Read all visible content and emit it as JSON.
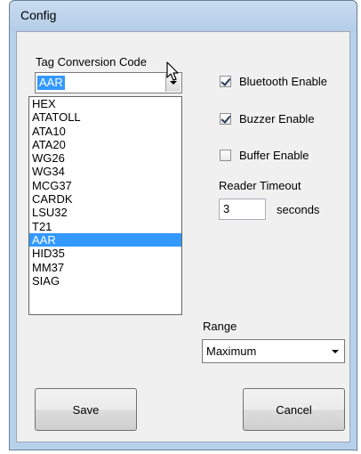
{
  "window": {
    "title": "Config"
  },
  "tag_conversion": {
    "label": "Tag Conversion Code",
    "value": "AAR",
    "options": [
      "HEX",
      "ATATOLL",
      "ATA10",
      "ATA20",
      "WG26",
      "WG34",
      "MCG37",
      "CARDK",
      "LSU32",
      "T21",
      "AAR",
      "HID35",
      "MM37",
      "SIAG"
    ],
    "selected_option": "AAR"
  },
  "checkboxes": {
    "bluetooth": {
      "label": "Bluetooth Enable",
      "checked": true
    },
    "buzzer": {
      "label": "Buzzer Enable",
      "checked": true
    },
    "buffer": {
      "label": "Buffer Enable",
      "checked": false
    }
  },
  "reader_timeout": {
    "label": "Reader Timeout",
    "value": "3",
    "unit": "seconds"
  },
  "range": {
    "label": "Range",
    "value": "Maximum"
  },
  "buttons": {
    "save": "Save",
    "cancel": "Cancel"
  },
  "icons": {
    "cursor": "mouse-pointer-icon",
    "combo_arrow": "chevron-down-icon",
    "check": "checkmark-icon"
  },
  "colors": {
    "selection": "#3399ff",
    "frame": "#b8d1ea",
    "client": "#f0f0f0"
  }
}
